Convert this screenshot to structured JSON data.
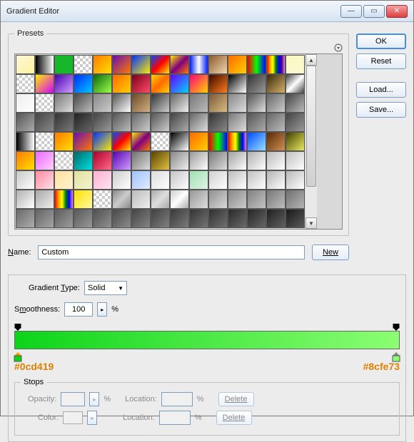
{
  "window": {
    "title": "Gradient Editor"
  },
  "buttons": {
    "ok": "OK",
    "reset": "Reset",
    "load": "Load...",
    "save": "Save...",
    "new": "New"
  },
  "presets": {
    "legend": "Presets",
    "rows": [
      [
        "linear-gradient(135deg,#fdf6d6,#fff3a0)",
        "linear-gradient(90deg,#000,#fff)",
        "#17b72b",
        "#0000",
        "linear-gradient(135deg,#ff7a00,#ffe000)",
        "linear-gradient(135deg,#6a0dad,#ff7a00)",
        "linear-gradient(135deg,#0034ff,#ffea00)",
        "linear-gradient(135deg,#004cff,#ff0000,#ffea00)",
        "linear-gradient(135deg,#ffea00,#800080,#ff7a00)",
        "linear-gradient(90deg,#001eff,#ffffff,#001eff)",
        "linear-gradient(135deg,#8a5a2a,#f2d8b0)",
        "linear-gradient(135deg,#ff6a00,#ffd000)",
        "linear-gradient(90deg,#ff0000,#00ff00,#0000ff)",
        "linear-gradient(90deg,red,orange,yellow,green,blue,indigo,violet)",
        "linear-gradient(135deg,#faf7c3,#fdf9d0)"
      ],
      [
        "#0000",
        "linear-gradient(135deg,#ffef00,#d400ff)",
        "linear-gradient(135deg,#4a00b0,#cfa0ff)",
        "linear-gradient(135deg,#002aff,#00c8ff)",
        "linear-gradient(135deg,#0a6a0a,#9cff4a)",
        "linear-gradient(135deg,#ff6a00,#ffd000)",
        "linear-gradient(135deg,#7a001a,#ff4a6a)",
        "linear-gradient(135deg,#ffd400,#ff6a00,#ffd400)",
        "linear-gradient(135deg,#6a00ff,#00d4ff)",
        "linear-gradient(135deg,#ff007a,#ffd400)",
        "linear-gradient(135deg,#3a0a00,#ff7a1a)",
        "linear-gradient(135deg,#000,#fff)",
        "linear-gradient(135deg,#333,#999)",
        "linear-gradient(135deg,#3a2a0a,#d4b06a)",
        "linear-gradient(135deg,#444,#fff,#444)"
      ],
      [
        "linear-gradient(135deg,#eee,#fff)",
        "#0000",
        "linear-gradient(135deg,#777,#ddd)",
        "linear-gradient(135deg,#4a4a4a,#bababa)",
        "linear-gradient(135deg,#888,#ccc)",
        "linear-gradient(135deg,#555,#fff)",
        "linear-gradient(135deg,#6a4a2a,#d4b080)",
        "linear-gradient(135deg,#333,#ccc)",
        "linear-gradient(135deg,#666,#eee)",
        "linear-gradient(135deg,#777,#bbb)",
        "linear-gradient(135deg,#7a5a3a,#dabc80)",
        "linear-gradient(135deg,#888,#ddd)",
        "linear-gradient(135deg,#555,#ddd)",
        "linear-gradient(135deg,#666,#ccc)",
        "linear-gradient(135deg,#444,#bbb)"
      ],
      [
        "linear-gradient(135deg,#555,#aaa)",
        "linear-gradient(135deg,#444,#888)",
        "linear-gradient(135deg,#333,#777)",
        "linear-gradient(135deg,#222,#666)",
        "linear-gradient(135deg,#444,#999)",
        "linear-gradient(135deg,#555,#bbb)",
        "linear-gradient(135deg,#666,#ccc)",
        "linear-gradient(135deg,#555,#ccc)",
        "linear-gradient(135deg,#444,#aaa)",
        "linear-gradient(135deg,#666,#ddd)",
        "linear-gradient(135deg,#333,#888)",
        "linear-gradient(135deg,#777,#ddd)",
        "linear-gradient(135deg,#555,#aaa)",
        "linear-gradient(135deg,#666,#bbb)",
        "linear-gradient(135deg,#444,#999)"
      ],
      [
        "linear-gradient(90deg,#000,#fff)",
        "#0000",
        "linear-gradient(135deg,#ff7a00,#ffe000)",
        "linear-gradient(135deg,#6a0dad,#ff7a00)",
        "linear-gradient(135deg,#0034ff,#ffea00)",
        "linear-gradient(135deg,#004cff,#ff0000,#ffea00)",
        "linear-gradient(135deg,#ffea00,#800080,#ff7a00)",
        "#0000",
        "linear-gradient(135deg,#000,#fff)",
        "linear-gradient(135deg,#ff6a00,#ffd000)",
        "linear-gradient(90deg,#ff0000,#00ff00,#0000ff)",
        "linear-gradient(90deg,red,orange,yellow,green,blue,violet)",
        "linear-gradient(135deg,#004cff,#9adfff)",
        "linear-gradient(135deg,#5a2a0a,#d09050)",
        "linear-gradient(135deg,#404000,#eaea60)"
      ],
      [
        "linear-gradient(135deg,#ff7a00,#ffe000)",
        "linear-gradient(135deg,#ea6aff,#ffd0ff)",
        "#0000",
        "linear-gradient(135deg,#006a6a,#00e0e0)",
        "linear-gradient(135deg,#b0002a,#ff6a8a)",
        "linear-gradient(135deg,#5a00b0,#cfa0ff)",
        "linear-gradient(135deg,#707070,#dcdcdc)",
        "linear-gradient(135deg,#584400,#e0c040)",
        "linear-gradient(135deg,#888,#eee)",
        "linear-gradient(135deg,#999,#fff)",
        "linear-gradient(135deg,#777,#ddd)",
        "linear-gradient(135deg,#a0a0a0,#fff)",
        "linear-gradient(135deg,#b0b0b0,#fff)",
        "linear-gradient(135deg,#bababa,#fff)",
        "linear-gradient(135deg,#c0c0c0,#fff)"
      ],
      [
        "linear-gradient(135deg,#c8c8c8,#fff)",
        "linear-gradient(135deg,#ff8aa0,#ffe0e8)",
        "linear-gradient(135deg,#ffe0a0,#fff4d0)",
        "linear-gradient(135deg,#e0e0a0,#f4f4d0)",
        "linear-gradient(135deg,#ffb0d0,#ffe4f0)",
        "linear-gradient(135deg,#ccc,#fff)",
        "linear-gradient(135deg,#a0c0ff,#e0ecff)",
        "linear-gradient(135deg,#dcdcdc,#fff)",
        "linear-gradient(135deg,#c4c4c4,#fff)",
        "linear-gradient(135deg,#a0e0b0,#e0f4e8)",
        "linear-gradient(135deg,#d0d0d0,#fff)",
        "linear-gradient(135deg,#bcbcbc,#fff)",
        "linear-gradient(135deg,#c0c0c0,#fff)",
        "linear-gradient(135deg,#b4b4b4,#fff)",
        "linear-gradient(135deg,#b8b8b8,#fff)"
      ],
      [
        "linear-gradient(135deg,#b0b0b0,#fff)",
        "linear-gradient(135deg,#a8a8a8,#eee)",
        "linear-gradient(90deg,red,orange,yellow,green,blue,violet)",
        "linear-gradient(135deg,#ffe000,#fff8a0)",
        "#0000",
        "linear-gradient(135deg,#888,#ccc,#888)",
        "linear-gradient(135deg,#bbb,#eee)",
        "linear-gradient(135deg,#aaa,#ddd,#aaa)",
        "linear-gradient(135deg,#ccc,#fff,#aaa)",
        "linear-gradient(135deg,#999,#ddd)",
        "linear-gradient(135deg,#909090,#d8d8d8)",
        "linear-gradient(135deg,#888,#ccc)",
        "linear-gradient(135deg,#808080,#c4c4c4)",
        "linear-gradient(135deg,#787878,#bcbcbc)",
        "linear-gradient(135deg,#707070,#b4b4b4)"
      ],
      [
        "linear-gradient(135deg,#6a6a6a,#acacac)",
        "linear-gradient(135deg,#646464,#a4a4a4)",
        "linear-gradient(135deg,#5c5c5c,#9c9c9c)",
        "linear-gradient(135deg,#585858,#989898)",
        "linear-gradient(135deg,#505050,#909090)",
        "linear-gradient(135deg,#4a4a4a,#8a8a8a)",
        "linear-gradient(135deg,#444,#848484)",
        "linear-gradient(135deg,#404040,#808080)",
        "linear-gradient(135deg,#3a3a3a,#7a7a7a)",
        "linear-gradient(135deg,#343434,#747474)",
        "linear-gradient(135deg,#303030,#707070)",
        "linear-gradient(135deg,#2a2a2a,#6a6a6a)",
        "linear-gradient(135deg,#262626,#666666)",
        "linear-gradient(135deg,#202020,#606060)",
        "linear-gradient(135deg,#1a1a1a,#5a5a5a)"
      ]
    ]
  },
  "name": {
    "label": "Name:",
    "value": "Custom"
  },
  "gradientType": {
    "label": "Gradient Type:",
    "value": "Solid"
  },
  "smoothness": {
    "label": "Smoothness:",
    "value": "100",
    "unit": "%"
  },
  "gradient": {
    "left_color": "#0cd419",
    "right_color": "#8cfe73",
    "left_label": "#0cd419",
    "right_label": "#8cfe73"
  },
  "stops": {
    "legend": "Stops",
    "opacity_label": "Opacity:",
    "opacity_unit": "%",
    "color_label": "Color:",
    "location_label": "Location:",
    "location_unit": "%",
    "delete": "Delete"
  }
}
